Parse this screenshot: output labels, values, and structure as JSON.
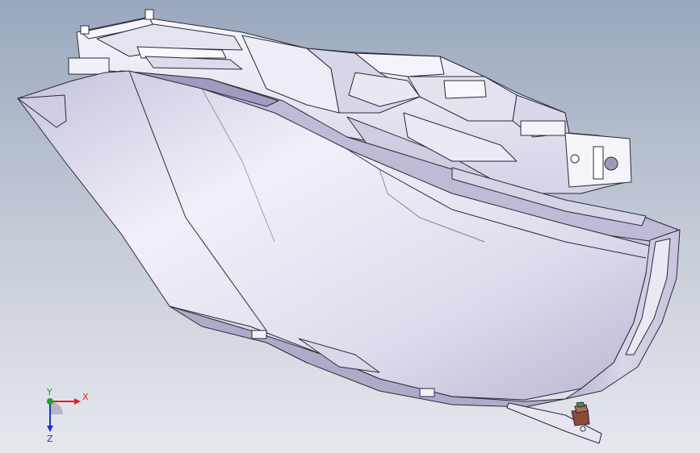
{
  "triad": {
    "x_label": "X",
    "y_label": "Y",
    "z_label": "Z"
  },
  "colors": {
    "background_top": "#9aa7bd",
    "background_bottom": "#e6e8ed",
    "model_body": "#e9e8f3",
    "model_shade": "#c9c7dc",
    "model_edge": "#2a2a3a",
    "axis_x": "#e02020",
    "axis_y": "#20a020",
    "axis_z": "#2030d0",
    "connector": "#8b4a3a"
  },
  "icons": {
    "triad": "coordinate-triad-icon",
    "bulb_connector": "bulb-connector-icon"
  }
}
